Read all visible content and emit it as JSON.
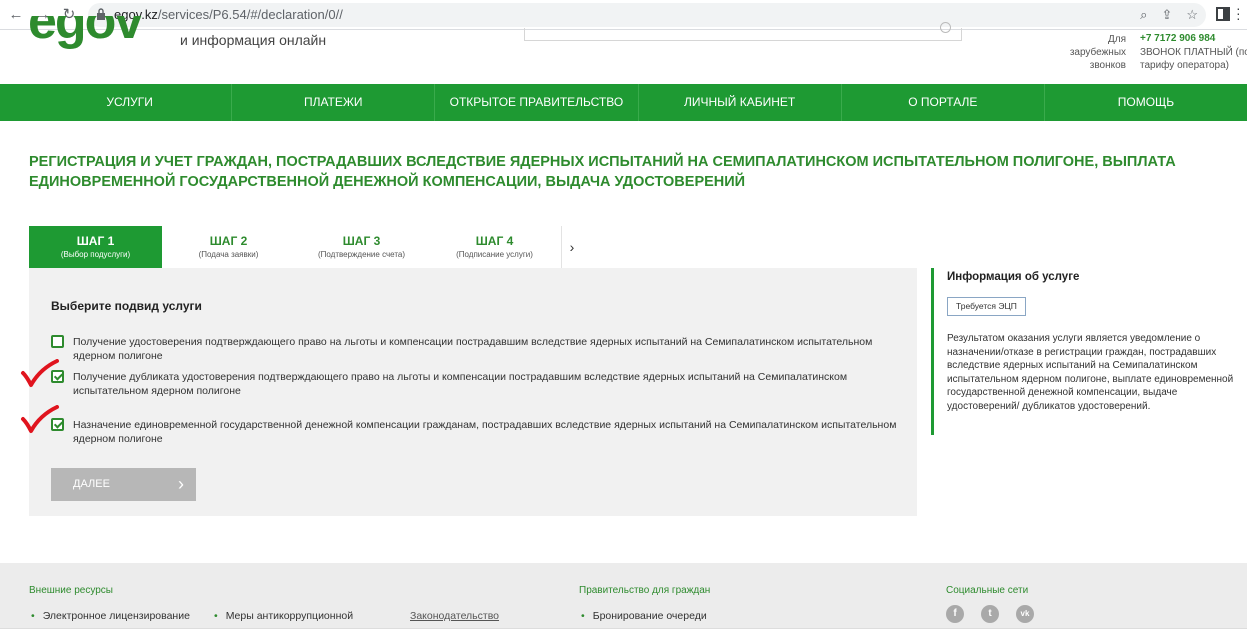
{
  "browser": {
    "url_host": "egov.kz",
    "url_path": "/services/P6.54/#/declaration/0//",
    "back_icon": "←",
    "forward_icon": "→",
    "reload_icon": "↻"
  },
  "header": {
    "logo_text": "egov",
    "tagline": "и информация онлайн",
    "contact_label": "Для зарубежных звонков",
    "phone": "+7 7172 906 984",
    "call_note": "ЗВОНОК ПЛАТНЫЙ (по тарифу оператора)"
  },
  "nav": {
    "items": [
      "Услуги",
      "Платежи",
      "Открытое правительство",
      "Личный кабинет",
      "О портале",
      "Помощь"
    ]
  },
  "page": {
    "title": "Регистрация и учет граждан, пострадавших вследствие ядерных испытаний на Семипалатинском испытательном полигоне, выплата единовременной государственной денежной компенсации, выдача удостоверений"
  },
  "steps": [
    {
      "title": "ШАГ 1",
      "sub": "(Выбор подуслуги)",
      "active": true
    },
    {
      "title": "ШАГ 2",
      "sub": "(Подача заявки)",
      "active": false
    },
    {
      "title": "ШАГ 3",
      "sub": "(Подтверждение счета)",
      "active": false
    },
    {
      "title": "ШАГ 4",
      "sub": "(Подписание услуги)",
      "active": false
    }
  ],
  "form": {
    "heading": "Выберите подвид услуги",
    "options": [
      {
        "label": "Получение удостоверения подтверждающего право на льготы и компенсации пострадавшим вследствие ядерных испытаний на Семипалатинском испытательном ядерном полигоне",
        "checked": false
      },
      {
        "label": "Получение дубликата удостоверения подтверждающего право на льготы и компенсации пострадавшим вследствие ядерных испытаний на Семипалатинском испытательном ядерном полигоне",
        "checked": true
      },
      {
        "label": "Назначение единовременной государственной денежной компенсации гражданам, пострадавших вследствие ядерных испытаний на Семипалатинском испытательном ядерном полигоне",
        "checked": true
      }
    ],
    "next_button": "Далее"
  },
  "info": {
    "title": "Информация об услуге",
    "badge": "Требуется ЭЦП",
    "text": "Результатом оказания услуги является уведомление о назначении/отказе в регистрации граждан, пострадавших вследствие ядерных испытаний на Семипалатинском испытательном ядерном полигоне, выплате единовременной государственной денежной компенсации, выдаче удостоверений/ дубликатов удостоверений."
  },
  "footer": {
    "col1_title": "Внешние ресурсы",
    "col1_links": [
      "Электронное лицензирование",
      "Меры антикоррупционной"
    ],
    "col1_extra": "Законодательство",
    "col2_title": "Правительство для граждан",
    "col2_links": [
      "Бронирование очереди"
    ],
    "col3_title": "Социальные сети",
    "social": [
      "f",
      "t",
      "vk"
    ]
  },
  "colors": {
    "brand_green": "#1e9a33",
    "text_green": "#2e8b2e",
    "annotation_red": "#e0141e"
  }
}
